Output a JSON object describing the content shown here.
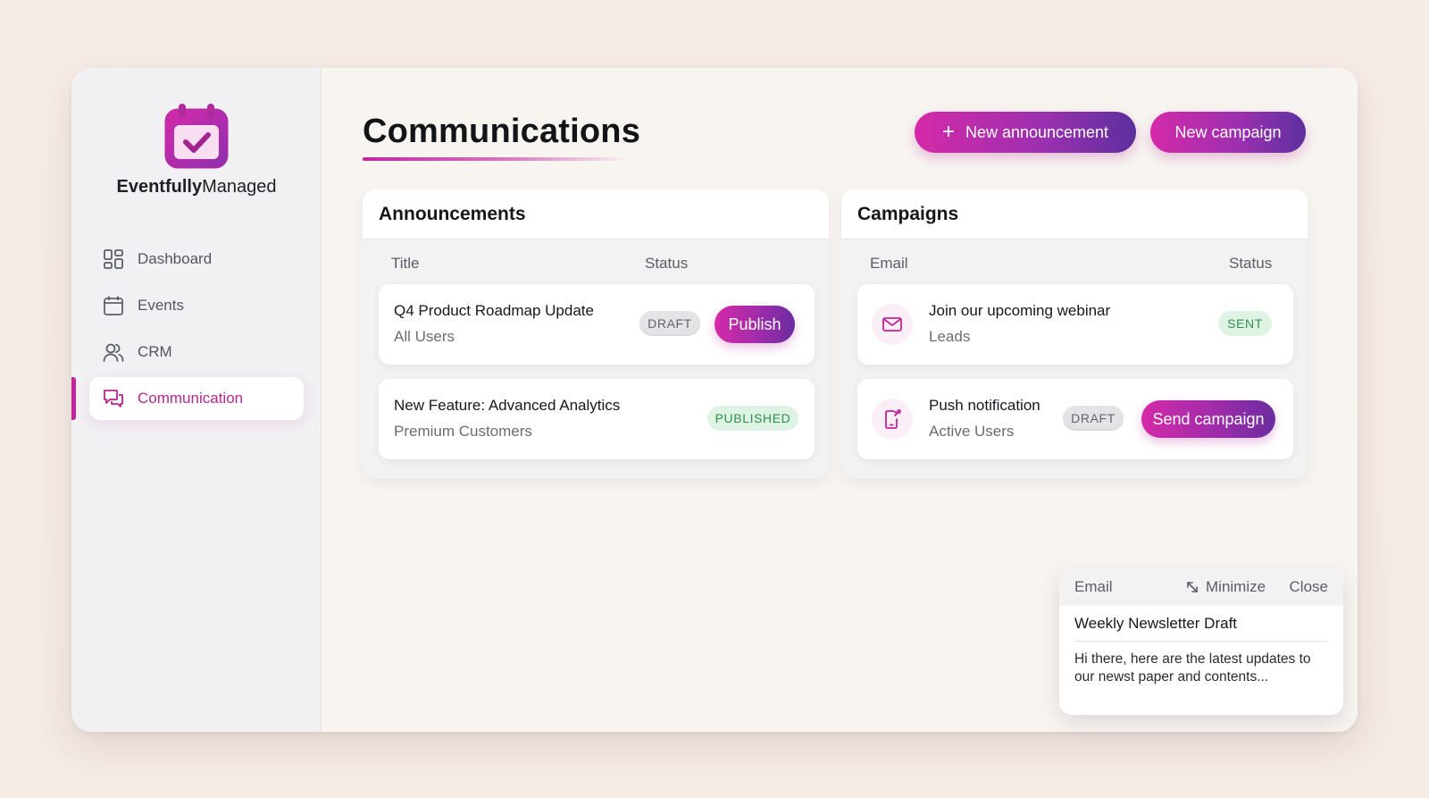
{
  "brand": {
    "name_bold": "Eventfully",
    "name_regular": "Managed",
    "logo_icon": "calendar-check-icon",
    "accent": "#c2259b"
  },
  "sidebar": {
    "items": [
      {
        "label": "Dashboard",
        "icon": "grid-icon",
        "active": false
      },
      {
        "label": "Events",
        "icon": "calendar-icon",
        "active": false
      },
      {
        "label": "CRM",
        "icon": "users-icon",
        "active": false
      },
      {
        "label": "Communication",
        "icon": "chat-icon",
        "active": true
      }
    ]
  },
  "header": {
    "title": "Communications",
    "new_announcement_label": "New announcement",
    "new_campaign_label": "New campaign"
  },
  "announcements": {
    "title": "Announcements",
    "col_title": "Title",
    "col_status": "Status",
    "rows": [
      {
        "title": "Q4 Product Roadmap Update",
        "audience": "All Users",
        "status": "DRAFT",
        "action": "Publish"
      },
      {
        "title": "New Feature: Advanced Analytics",
        "audience": "Premium Customers",
        "status": "PUBLISHED"
      }
    ]
  },
  "campaigns": {
    "title": "Campaigns",
    "col_type": "Email",
    "col_status": "Status",
    "rows": [
      {
        "icon": "mail-icon",
        "title": "Join our upcoming webinar",
        "audience": "Leads",
        "status": "SENT"
      },
      {
        "icon": "phone-notification-icon",
        "title": "Push notification",
        "audience": "Active Users",
        "status": "DRAFT",
        "action": "Send campaign"
      }
    ]
  },
  "compose": {
    "type": "Email",
    "minimize_label": "Minimize",
    "close_label": "Close",
    "subject": "Weekly Newsletter Draft",
    "body": "Hi there, here are the latest updates to our newst paper and contents..."
  },
  "colors": {
    "gradient_start": "#d42aa8",
    "gradient_end": "#5d2f9d",
    "success_bg": "#dff3e5",
    "success_text": "#2f8f4e",
    "draft_bg": "#e4e3e6"
  }
}
